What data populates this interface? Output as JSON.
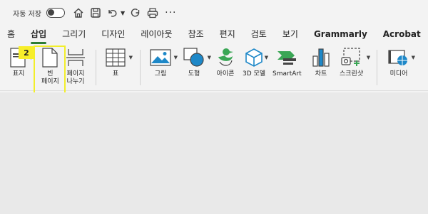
{
  "qat": {
    "autosave_label": "자동 저장",
    "icons": [
      "home-icon",
      "save-icon",
      "undo-icon",
      "redo-icon",
      "print-icon"
    ],
    "more_label": "···"
  },
  "tabs": [
    {
      "label": "홈"
    },
    {
      "label": "삽입"
    },
    {
      "label": "그리기"
    },
    {
      "label": "디자인"
    },
    {
      "label": "레이아웃"
    },
    {
      "label": "참조"
    },
    {
      "label": "편지"
    },
    {
      "label": "검토"
    },
    {
      "label": "보기"
    },
    {
      "label": "Grammarly"
    },
    {
      "label": "Acrobat"
    }
  ],
  "active_tab": "삽입",
  "ribbon": {
    "cover_page": {
      "label": "표지"
    },
    "blank_page": {
      "label_line1": "빈",
      "label_line2": "페이지"
    },
    "page_break": {
      "label_line1": "페이지",
      "label_line2": "나누기"
    },
    "table": {
      "label": "표"
    },
    "pictures": {
      "label": "그림"
    },
    "shapes": {
      "label": "도형"
    },
    "icons": {
      "label": "아이콘"
    },
    "models_3d": {
      "label": "3D 모델"
    },
    "smartart": {
      "label": "SmartArt"
    },
    "chart": {
      "label": "차트"
    },
    "screenshot": {
      "label": "스크린샷"
    },
    "media": {
      "label": "미디어"
    }
  },
  "annotation": {
    "badge": "2",
    "highlight_color": "#f7ee2a"
  },
  "colors": {
    "accent": "#2e7d32",
    "shape_blue": "#1e88c8",
    "icon_green": "#3aa655"
  }
}
